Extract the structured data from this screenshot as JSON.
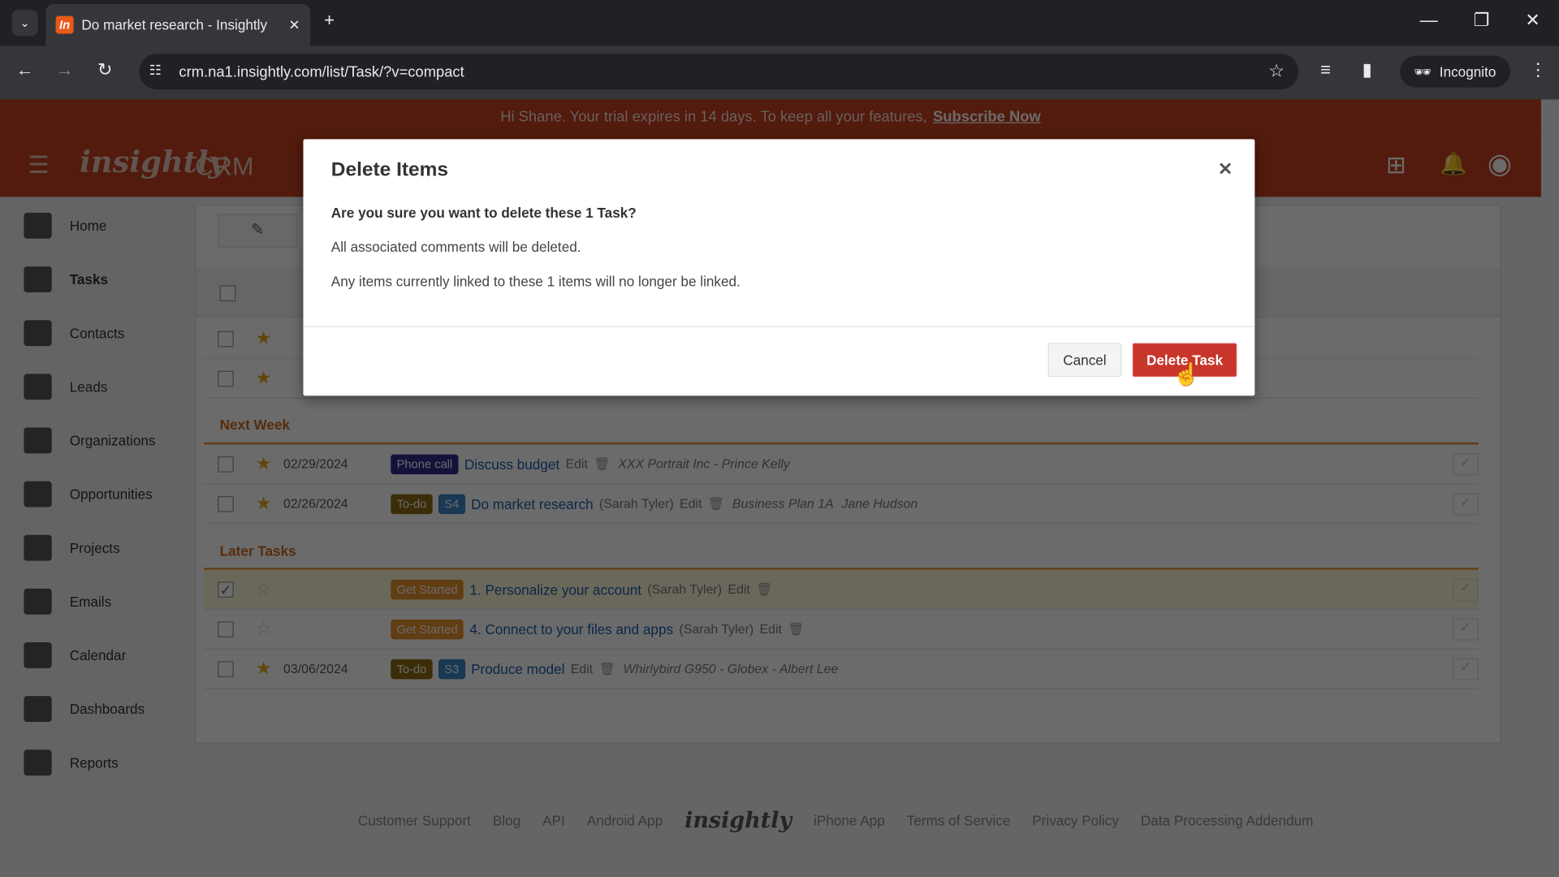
{
  "browser": {
    "tab_title": "Do market research - Insightly",
    "url": "crm.na1.insightly.com/list/Task/?v=compact",
    "profile": "Incognito"
  },
  "banner": {
    "text": "Hi Shane. Your trial expires in 14 days. To keep all your features,",
    "link": "Subscribe Now"
  },
  "header": {
    "logo": "insightly",
    "product": "CRM"
  },
  "sidebar": {
    "items": [
      {
        "label": "Home"
      },
      {
        "label": "Tasks"
      },
      {
        "label": "Contacts"
      },
      {
        "label": "Leads"
      },
      {
        "label": "Organizations"
      },
      {
        "label": "Opportunities"
      },
      {
        "label": "Projects"
      },
      {
        "label": "Emails"
      },
      {
        "label": "Calendar"
      },
      {
        "label": "Dashboards"
      },
      {
        "label": "Reports"
      }
    ]
  },
  "groups": {
    "next_week": "Next Week",
    "later": "Later Tasks"
  },
  "tasks": [
    {
      "date": "02/29/2024",
      "type": "Phone call",
      "type_color": "#2e2a8c",
      "title": "Discuss budget",
      "edit": "Edit",
      "link": "XXX Portrait Inc - Prince Kelly"
    },
    {
      "date": "02/26/2024",
      "type": "To-do",
      "type_color": "#8a6a10",
      "stage": "S4",
      "title": "Do market research",
      "owner": "(Sarah Tyler)",
      "edit": "Edit",
      "link": "Business Plan 1A",
      "contact": "Jane Hudson"
    },
    {
      "date": "",
      "type": "Get Started",
      "type_color": "#e8912e",
      "title": "1. Personalize your account",
      "owner": "(Sarah Tyler)",
      "edit": "Edit",
      "checked": true
    },
    {
      "date": "",
      "type": "Get Started",
      "type_color": "#e8912e",
      "title": "4. Connect to your files and apps",
      "owner": "(Sarah Tyler)",
      "edit": "Edit"
    },
    {
      "date": "03/06/2024",
      "type": "To-do",
      "type_color": "#8a6a10",
      "stage": "S3",
      "title": "Produce model",
      "edit": "Edit",
      "link": "Whirlybird G950 - Globex - Albert Lee"
    }
  ],
  "footer": {
    "links": [
      "Customer Support",
      "Blog",
      "API",
      "Android App",
      "iPhone App",
      "Terms of Service",
      "Privacy Policy",
      "Data Processing Addendum"
    ],
    "logo": "insightly"
  },
  "dialog": {
    "title": "Delete Items",
    "question": "Are you sure you want to delete these 1 Task?",
    "line1": "All associated comments will be deleted.",
    "line2": "Any items currently linked to these 1 items will no longer be linked.",
    "cancel": "Cancel",
    "confirm": "Delete Task",
    "confirm_color": "#c8352a"
  }
}
